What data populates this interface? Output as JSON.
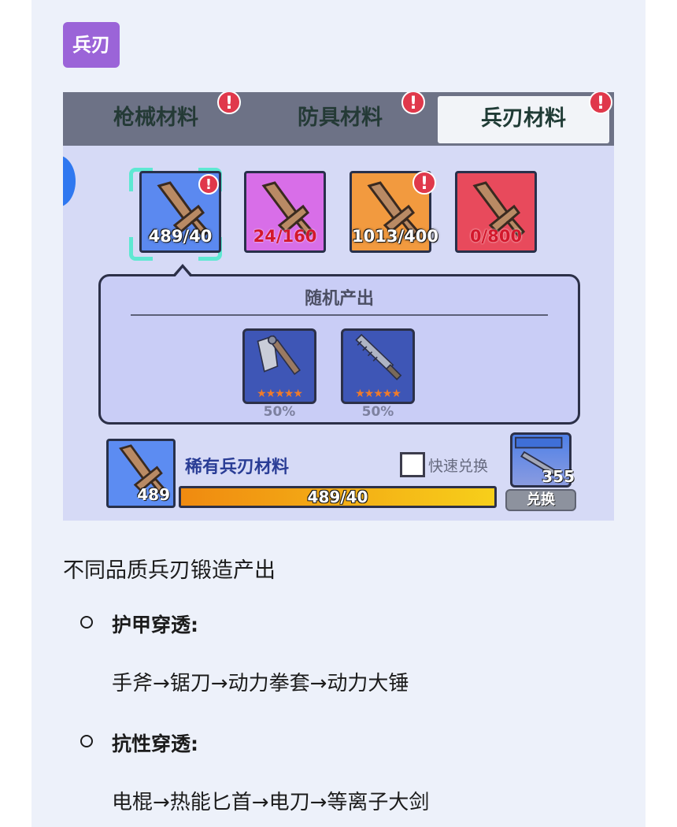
{
  "tag": "兵刃",
  "screenshot": {
    "tabs": [
      {
        "label": "枪械材料",
        "badge": "!"
      },
      {
        "label": "防具材料",
        "badge": "!"
      },
      {
        "label": "兵刃材料",
        "badge": "!"
      }
    ],
    "materials": [
      {
        "count": "489/40",
        "color": "#5b89f0",
        "badge": "!"
      },
      {
        "count": "24/160",
        "color": "#d86ee8"
      },
      {
        "count": "1013/400",
        "color": "#f29a3f",
        "badge": "!"
      },
      {
        "count": "0/800",
        "color": "#e84a5c"
      }
    ],
    "random_output": {
      "title": "随机产出",
      "items": [
        {
          "name": "axe-icon",
          "stars": "★★★★★",
          "percent": "50%"
        },
        {
          "name": "saw-blade-icon",
          "stars": "★★★★★",
          "percent": "50%"
        }
      ]
    },
    "selected_material": {
      "name": "稀有兵刃材料",
      "count": "489",
      "progress_text": "489/40",
      "progress_fraction": 1.0
    },
    "quick_exchange_label": "快速兑换",
    "exchange": {
      "count": "355",
      "label": "兑换"
    }
  },
  "description": "不同品质兵刃锻造产出",
  "sections": [
    {
      "title": "护甲穿透",
      "colon": ":",
      "chain": "手斧→锯刀→动力拳套→动力大锤"
    },
    {
      "title": "抗性穿透",
      "colon": ":",
      "chain": "电棍→热能匕首→电刀→等离子大剑"
    }
  ]
}
